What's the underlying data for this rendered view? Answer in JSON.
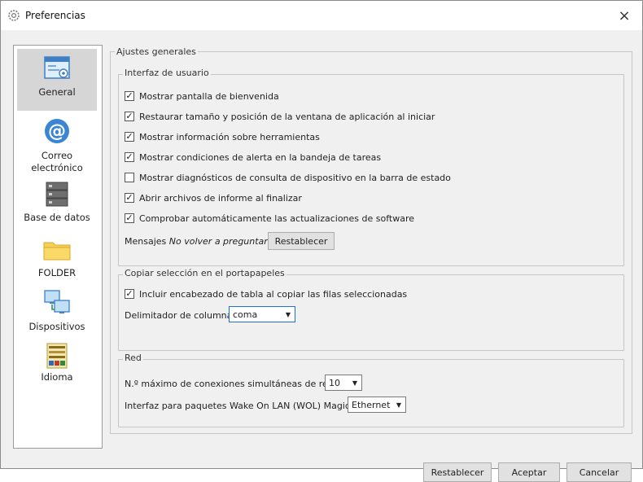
{
  "window": {
    "title": "Preferencias",
    "close_label": "×"
  },
  "sidebar": {
    "items": [
      {
        "label": "General",
        "icon": "general-window-icon",
        "selected": true
      },
      {
        "label": "Correo\nelectrónico",
        "icon": "at-sign-icon",
        "selected": false
      },
      {
        "label": "Base de datos",
        "icon": "database-icon",
        "selected": false
      },
      {
        "label": "FOLDER",
        "icon": "folder-icon",
        "selected": false
      },
      {
        "label": "Dispositivos",
        "icon": "devices-icon",
        "selected": false
      },
      {
        "label": "Idioma",
        "icon": "language-icon",
        "selected": false
      }
    ]
  },
  "main": {
    "group_title": "Ajustes generales",
    "ui_section": {
      "label": "Interfaz de usuario",
      "checkboxes": [
        {
          "label": "Mostrar pantalla de bienvenida",
          "checked": true
        },
        {
          "label": "Restaurar tamaño y posición de la ventana de aplicación al iniciar",
          "checked": true
        },
        {
          "label": "Mostrar información sobre herramientas",
          "checked": true
        },
        {
          "label": "Mostrar condiciones de alerta en la bandeja de tareas",
          "checked": true
        },
        {
          "label": "Mostrar diagnósticos de consulta de dispositivo en la barra de estado",
          "checked": false
        },
        {
          "label": "Abrir archivos de informe al finalizar",
          "checked": true
        },
        {
          "label": "Comprobar automáticamente las actualizaciones de software",
          "checked": true
        }
      ],
      "messages_prefix": "Mensajes ",
      "messages_italic": "No volver a preguntar",
      "messages_suffix": ":",
      "reset_button": "Restablecer"
    },
    "copy_section": {
      "label": "Copiar selección en el portapapeles",
      "checkbox": {
        "label": "Incluir encabezado de tabla al copiar las filas seleccionadas",
        "checked": true
      },
      "delimiter_label": "Delimitador de columna:",
      "delimiter_value": "coma"
    },
    "network_section": {
      "label": "Red",
      "max_conn_label": "N.º máximo de conexiones simultáneas de red:",
      "max_conn_value": "10",
      "wol_label": "Interfaz para paquetes Wake On LAN (WOL) Magic:",
      "wol_value": "Ethernet"
    }
  },
  "footer": {
    "reset": "Restablecer",
    "accept": "Aceptar",
    "cancel": "Cancelar"
  },
  "check_glyph": "✓",
  "arrow_glyph": "▼"
}
